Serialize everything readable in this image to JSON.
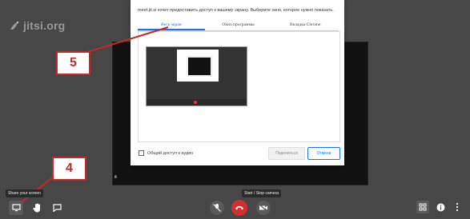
{
  "logo": {
    "text": "jitsi.org"
  },
  "dialog": {
    "message": "meet.jit.si хочет предоставить доступ к вашему экрану. Выберите окно, которое нужно показать.",
    "tabs": [
      {
        "label": "Весь экран",
        "active": true
      },
      {
        "label": "Окно программы",
        "active": false
      },
      {
        "label": "Вкладка Chrome",
        "active": false
      }
    ],
    "audio_checkbox_label": "Общий доступ к аудио",
    "share_button": "Поделиться",
    "cancel_button": "Отмена"
  },
  "annotations": {
    "step_5": "5",
    "step_4": "4"
  },
  "tile": {
    "label": "ili"
  },
  "toolbar": {
    "share_tooltip": "Share your screen",
    "camera_tooltip": "Start / Stop camera"
  },
  "colors": {
    "accent": "#1a73e8",
    "annotation": "#c62828",
    "hangup": "#d32f2f"
  }
}
